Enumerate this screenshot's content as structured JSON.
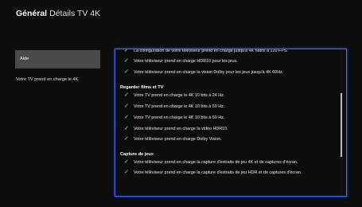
{
  "header": {
    "title": "Général",
    "subtitle": "Détails TV 4K"
  },
  "sidebar": {
    "item_label": "Aide",
    "description": "Votre TV prend en charge le 4K."
  },
  "panel": {
    "top_items": [
      "La configuration de votre téléviseur prend en charge jusqu'à 4K natifs à 120 FPS.",
      "Votre téléviseur prend en charge HDR10 pour les jeux.",
      "Votre téléviseur prend en charge la vision Dolby pour les jeux jusqu'à 4K 60Hz."
    ],
    "sections": [
      {
        "title": "Regarder films et TV",
        "items": [
          "Votre TV prend en charge le 4K 10 bits à 24 Hz.",
          "Votre TV prend en charge le 4K 10 bits à 50 Hz.",
          "Votre TV prend en charge le 4K 10 bits à 60 Hz.",
          "Votre téléviseur prend en charge la vidéo HDR10.",
          "Votre téléviseur prend en charge Dolby Vision."
        ]
      },
      {
        "title": "Capture de jeux",
        "items": [
          "Votre téléviseur prend en charge la capture d'extraits de jeu 4K et de captures d'écran.",
          "Votre téléviseur prend en charge la capture d'extraits de jeu HDR et de captures d'écran."
        ]
      }
    ]
  },
  "icons": {
    "check": "checkmark-icon"
  },
  "colors": {
    "accent_border": "#4a6cf7",
    "check": "#3ec43e"
  }
}
